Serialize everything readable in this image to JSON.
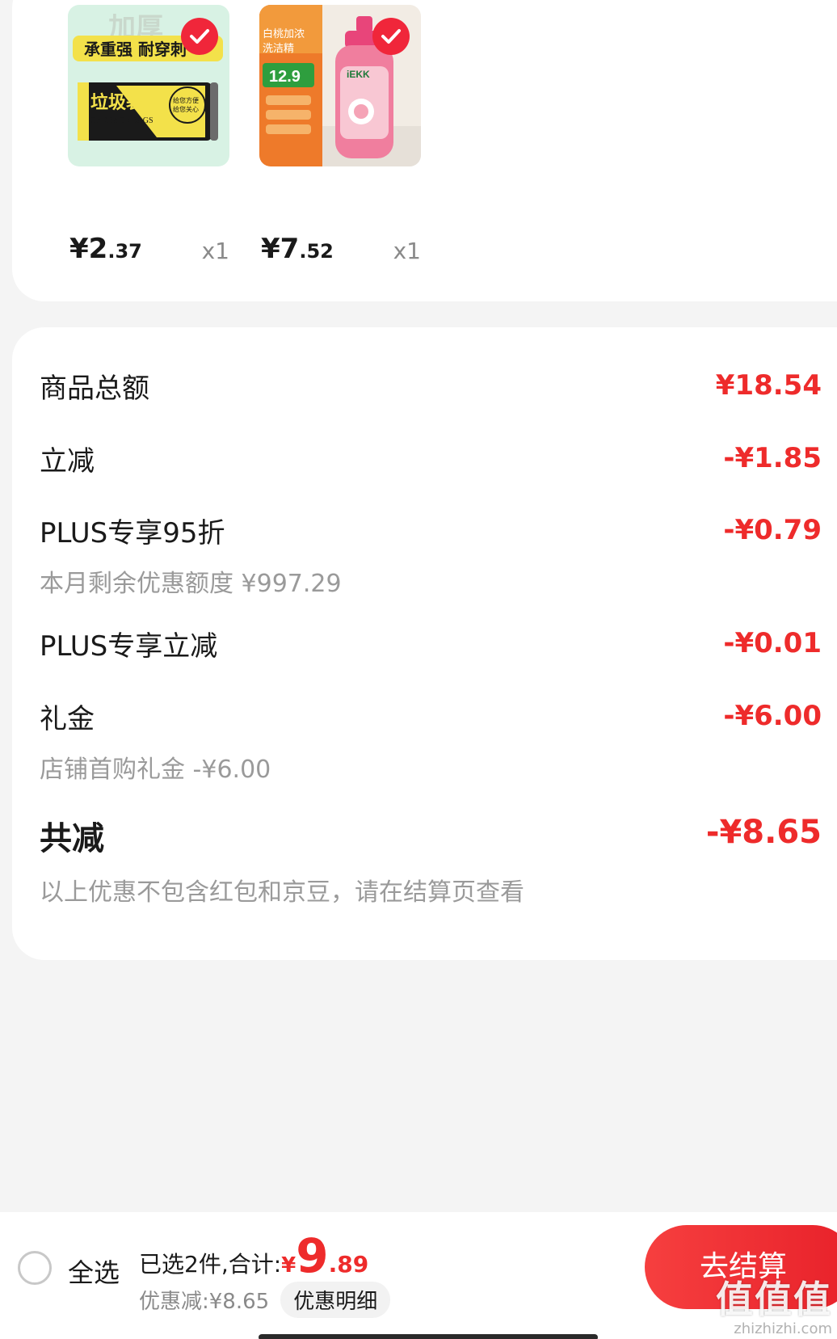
{
  "colors": {
    "accent": "#ee2b2b",
    "checkout_bg": "#f0263a",
    "card_bg": "#ffffff",
    "page_bg": "#f4f4f4"
  },
  "products": [
    {
      "image_text": [
        "承重强 耐穿刺",
        "垃圾袋",
        "GARBAGE BAGS",
        "给您方便",
        "给您关心"
      ],
      "price_int": "¥2",
      "price_dec": ".37",
      "qty": "x1",
      "selected_icon": "check-icon"
    },
    {
      "image_text": [
        "白桃加浓",
        "洗洁精",
        "12.9",
        "iEKK"
      ],
      "price_int": "¥7",
      "price_dec": ".52",
      "qty": "x1",
      "selected_icon": "check-icon"
    }
  ],
  "summary": {
    "goods_total_label": "商品总额",
    "goods_total_value": "¥18.54",
    "instant_cut_label": "立减",
    "instant_cut_value": "-¥1.85",
    "plus95_label": "PLUS专享95折",
    "plus95_value": "-¥0.79",
    "plus95_sub": "本月剩余优惠额度 ¥997.29",
    "plus_cut_label": "PLUS专享立减",
    "plus_cut_value": "-¥0.01",
    "gift_label": "礼金",
    "gift_value": "-¥6.00",
    "gift_sub": "店铺首购礼金 -¥6.00",
    "total_cut_label": "共减",
    "total_cut_value": "-¥8.65",
    "total_cut_note": "以上优惠不包含红包和京豆，请在结算页查看"
  },
  "bottom_bar": {
    "select_all_label": "全选",
    "selected_text": "已选2件,合计:",
    "currency": "¥",
    "total_int": "9",
    "total_dec": ".89",
    "discount_text": "优惠减:¥8.65",
    "detail_label": "优惠明细",
    "checkout_label": "去结算"
  },
  "watermark": {
    "brand": "值值值",
    "site": "zhizhizhi.com"
  }
}
